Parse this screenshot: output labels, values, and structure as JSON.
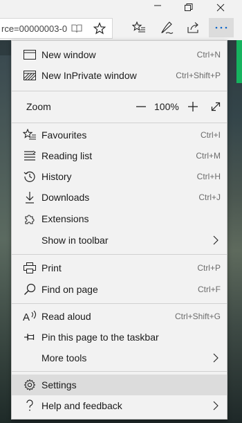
{
  "toolbar": {
    "address_text": "rce=00000003-0"
  },
  "menu": {
    "items": [
      {
        "label": "New window",
        "shortcut": "Ctrl+N"
      },
      {
        "label": "New InPrivate window",
        "shortcut": "Ctrl+Shift+P"
      },
      {
        "label": "Favourites",
        "shortcut": "Ctrl+I"
      },
      {
        "label": "Reading list",
        "shortcut": "Ctrl+M"
      },
      {
        "label": "History",
        "shortcut": "Ctrl+H"
      },
      {
        "label": "Downloads",
        "shortcut": "Ctrl+J"
      },
      {
        "label": "Extensions",
        "shortcut": ""
      },
      {
        "label": "Show in toolbar",
        "shortcut": ""
      },
      {
        "label": "Print",
        "shortcut": "Ctrl+P"
      },
      {
        "label": "Find on page",
        "shortcut": "Ctrl+F"
      },
      {
        "label": "Read aloud",
        "shortcut": "Ctrl+Shift+G"
      },
      {
        "label": "Pin this page to the taskbar",
        "shortcut": ""
      },
      {
        "label": "More tools",
        "shortcut": ""
      },
      {
        "label": "Settings",
        "shortcut": ""
      },
      {
        "label": "Help and feedback",
        "shortcut": ""
      }
    ],
    "zoom": {
      "label": "Zoom",
      "value": "100%",
      "decrease": "—",
      "increase": "+"
    }
  },
  "colors": {
    "menu_bg": "#f2f2f2",
    "hover_bg": "#dcdcdc",
    "accent_green": "#16b35f"
  },
  "icons": {
    "new_window": "window-icon",
    "inprivate": "inprivate-window-icon",
    "favourites": "star-list-icon",
    "reading_list": "reading-list-icon",
    "history": "history-clock-icon",
    "downloads": "download-arrow-icon",
    "extensions": "puzzle-icon",
    "print": "printer-icon",
    "find": "search-icon",
    "read_aloud": "read-aloud-icon",
    "pin": "pin-icon",
    "settings": "gear-icon",
    "help": "question-icon"
  }
}
